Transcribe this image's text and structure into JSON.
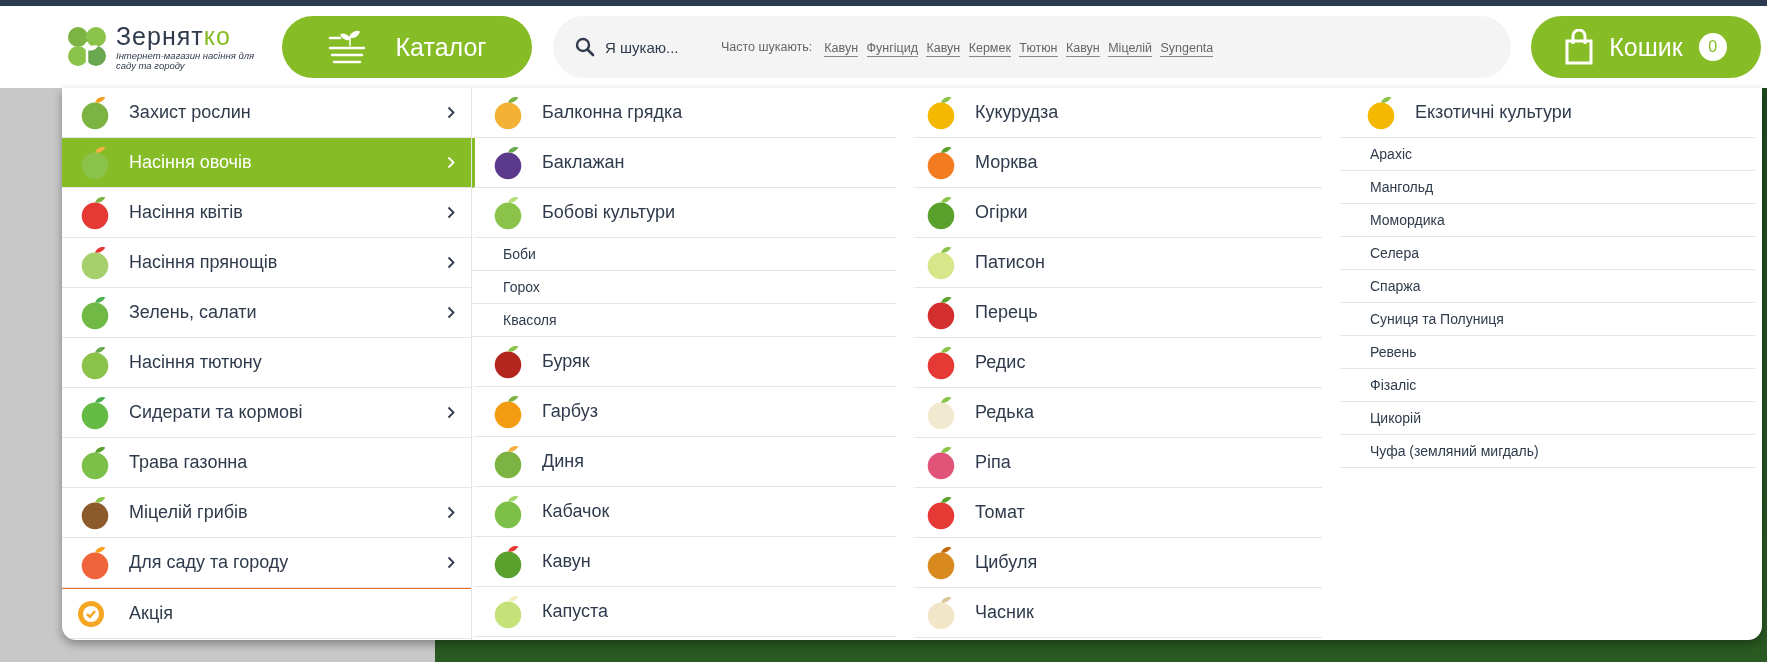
{
  "header": {
    "logo": {
      "name": "Зернятко",
      "tagline": "Інтернет-магазин насіння для саду та городу"
    },
    "catalog_button": {
      "label": "Каталог"
    },
    "search": {
      "placeholder": "Я шукаю...",
      "popular_label": "Часто шукають:",
      "popular": [
        "Кавун",
        "Фунгіцид",
        "Кавун",
        "Кермек",
        "Тютюн",
        "Кавун",
        "Міцелій",
        "Syngenta"
      ]
    },
    "cart": {
      "label": "Кошик",
      "count": "0"
    }
  },
  "menu": {
    "categories": [
      {
        "label": "Захист рослин",
        "has_submenu": true,
        "selected": false
      },
      {
        "label": "Насіння овочів",
        "has_submenu": true,
        "selected": true
      },
      {
        "label": "Насіння квітів",
        "has_submenu": true,
        "selected": false
      },
      {
        "label": "Насіння прянощів",
        "has_submenu": true,
        "selected": false
      },
      {
        "label": "Зелень, салати",
        "has_submenu": true,
        "selected": false
      },
      {
        "label": "Насіння тютюну",
        "has_submenu": false,
        "selected": false
      },
      {
        "label": "Сидерати та кормові",
        "has_submenu": true,
        "selected": false
      },
      {
        "label": "Трава газонна",
        "has_submenu": false,
        "selected": false
      },
      {
        "label": "Міцелій грибів",
        "has_submenu": true,
        "selected": false
      },
      {
        "label": "Для саду та городу",
        "has_submenu": true,
        "selected": false
      },
      {
        "label": "Акція",
        "has_submenu": false,
        "selected": false,
        "kind": "promo"
      }
    ],
    "columns": [
      [
        {
          "kind": "item",
          "label": "Балконна грядка",
          "hovered": false
        },
        {
          "kind": "item",
          "label": "Баклажан",
          "hovered": true
        },
        {
          "kind": "item",
          "label": "Бобові культури",
          "hovered": false
        },
        {
          "kind": "sub",
          "label": "Боби"
        },
        {
          "kind": "sub",
          "label": "Горох"
        },
        {
          "kind": "sub",
          "label": "Квасоля"
        },
        {
          "kind": "item",
          "label": "Буряк",
          "hovered": false
        },
        {
          "kind": "item",
          "label": "Гарбуз",
          "hovered": false
        },
        {
          "kind": "item",
          "label": "Диня",
          "hovered": false
        },
        {
          "kind": "item",
          "label": "Кабачок",
          "hovered": false
        },
        {
          "kind": "item",
          "label": "Кавун",
          "hovered": false
        },
        {
          "kind": "item",
          "label": "Капуста",
          "hovered": false
        }
      ],
      [
        {
          "kind": "item",
          "label": "Кукурудза",
          "hovered": false
        },
        {
          "kind": "item",
          "label": "Морква",
          "hovered": false
        },
        {
          "kind": "item",
          "label": "Огірки",
          "hovered": false
        },
        {
          "kind": "item",
          "label": "Патисон",
          "hovered": false
        },
        {
          "kind": "item",
          "label": "Перець",
          "hovered": false
        },
        {
          "kind": "item",
          "label": "Редис",
          "hovered": false
        },
        {
          "kind": "item",
          "label": "Редька",
          "hovered": false
        },
        {
          "kind": "item",
          "label": "Ріпа",
          "hovered": false
        },
        {
          "kind": "item",
          "label": "Томат",
          "hovered": false
        },
        {
          "kind": "item",
          "label": "Цибуля",
          "hovered": false
        },
        {
          "kind": "item",
          "label": "Часник",
          "hovered": false
        }
      ],
      [
        {
          "kind": "heading",
          "label": "Екзотичні культури"
        },
        {
          "kind": "sub",
          "label": "Арахіс"
        },
        {
          "kind": "sub",
          "label": "Мангольд"
        },
        {
          "kind": "sub",
          "label": "Момордика"
        },
        {
          "kind": "sub",
          "label": "Селера"
        },
        {
          "kind": "sub",
          "label": "Спаржа"
        },
        {
          "kind": "sub",
          "label": "Суниця та Полуниця"
        },
        {
          "kind": "sub",
          "label": "Ревень"
        },
        {
          "kind": "sub",
          "label": "Фізаліс"
        },
        {
          "kind": "sub",
          "label": "Цикорій"
        },
        {
          "kind": "sub",
          "label": "Чуфа (земляний мигдаль)"
        }
      ]
    ]
  }
}
